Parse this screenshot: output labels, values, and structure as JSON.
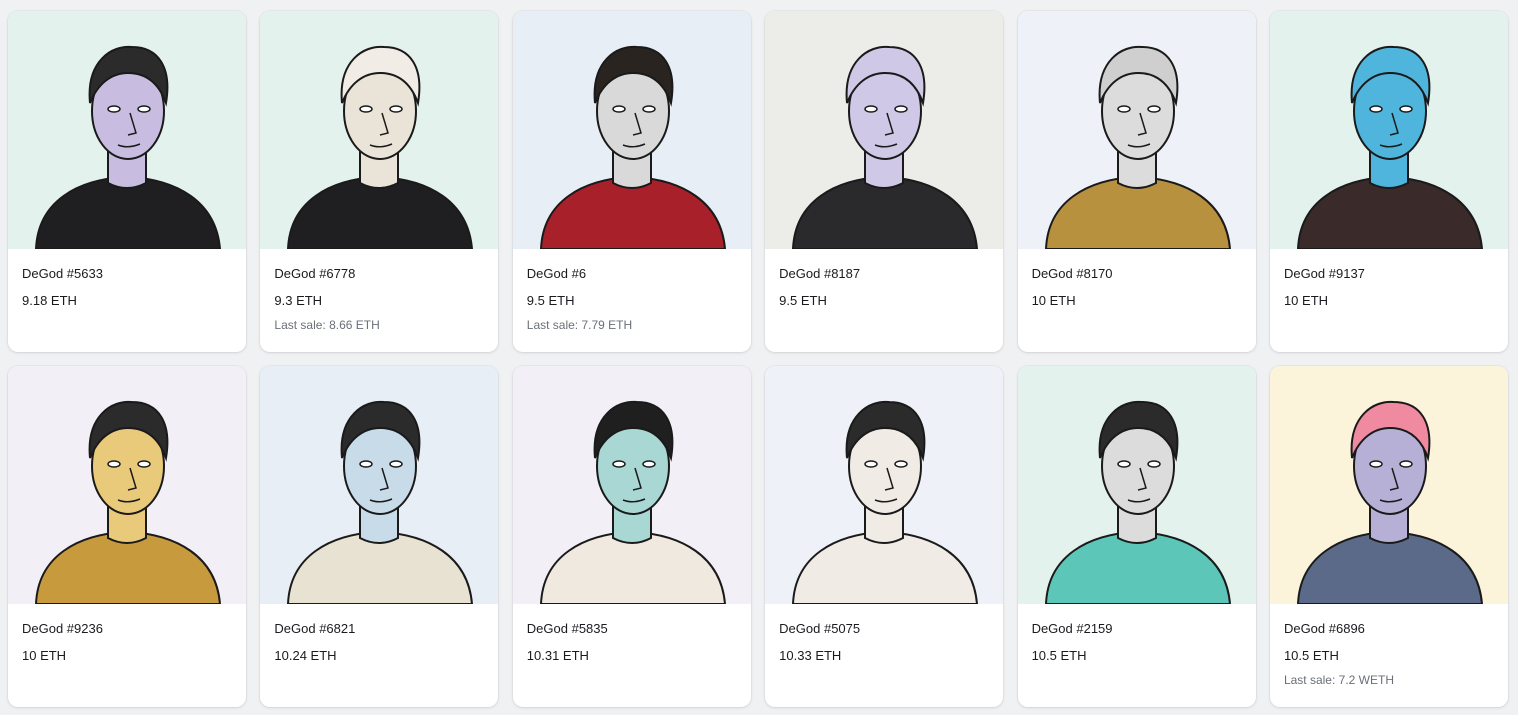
{
  "items": [
    {
      "name": "DeGod #5633",
      "price": "9.18 ETH",
      "last_sale": "",
      "bg": "#e3f2ec",
      "skin": "#c8bde0",
      "hair": "#2b2b2b",
      "shirt": "#1f1f22"
    },
    {
      "name": "DeGod #6778",
      "price": "9.3 ETH",
      "last_sale": "Last sale: 8.66 ETH",
      "bg": "#e3f2ec",
      "skin": "#e9e3d8",
      "hair": "#f2ece6",
      "shirt": "#1f1f22"
    },
    {
      "name": "DeGod #6",
      "price": "9.5 ETH",
      "last_sale": "Last sale: 7.79 ETH",
      "bg": "#e8eef6",
      "skin": "#d9d9d9",
      "hair": "#2a2420",
      "shirt": "#a8202a"
    },
    {
      "name": "DeGod #8187",
      "price": "9.5 ETH",
      "last_sale": "",
      "bg": "#ecece8",
      "skin": "#cfc8e6",
      "hair": "#cfc8e6",
      "shirt": "#2a2a2d"
    },
    {
      "name": "DeGod #8170",
      "price": "10 ETH",
      "last_sale": "",
      "bg": "#eef1f8",
      "skin": "#dcdcdc",
      "hair": "#cfcfcf",
      "shirt": "#b8913f"
    },
    {
      "name": "DeGod #9137",
      "price": "10 ETH",
      "last_sale": "",
      "bg": "#e3f2ec",
      "skin": "#4fb5dc",
      "hair": "#4fb5dc",
      "shirt": "#3a2a2a"
    },
    {
      "name": "DeGod #9236",
      "price": "10 ETH",
      "last_sale": "",
      "bg": "#f3eff6",
      "skin": "#e9c97a",
      "hair": "#2b2b2b",
      "shirt": "#c79a3d"
    },
    {
      "name": "DeGod #6821",
      "price": "10.24 ETH",
      "last_sale": "",
      "bg": "#e8eef6",
      "skin": "#c7dbe8",
      "hair": "#2b2b2b",
      "shirt": "#e8e2d2"
    },
    {
      "name": "DeGod #5835",
      "price": "10.31 ETH",
      "last_sale": "",
      "bg": "#f3eff6",
      "skin": "#a9d7d4",
      "hair": "#1f1f1f",
      "shirt": "#efe9df"
    },
    {
      "name": "DeGod #5075",
      "price": "10.33 ETH",
      "last_sale": "",
      "bg": "#eef1f8",
      "skin": "#f1ebe6",
      "hair": "#2b2b2b",
      "shirt": "#f1ebe6"
    },
    {
      "name": "DeGod #2159",
      "price": "10.5 ETH",
      "last_sale": "",
      "bg": "#e3f2ec",
      "skin": "#dcdcdc",
      "hair": "#2b2b2b",
      "shirt": "#5cc7b8"
    },
    {
      "name": "DeGod #6896",
      "price": "10.5 ETH",
      "last_sale": "Last sale: 7.2 WETH",
      "bg": "#fbf3da",
      "skin": "#b7b0d6",
      "hair": "#f08aa0",
      "shirt": "#5a6a88"
    }
  ]
}
